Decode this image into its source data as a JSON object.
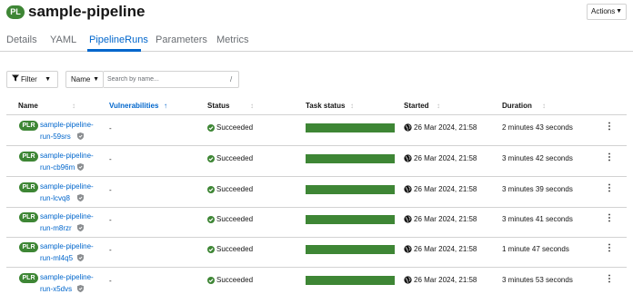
{
  "header": {
    "badge": "PL",
    "title": "sample-pipeline",
    "actions_label": "Actions"
  },
  "tabs": [
    {
      "label": "Details"
    },
    {
      "label": "YAML"
    },
    {
      "label": "PipelineRuns"
    },
    {
      "label": "Parameters"
    },
    {
      "label": "Metrics"
    }
  ],
  "toolbar": {
    "filter_label": "Filter",
    "name_select": "Name",
    "search_placeholder": "Search by name...",
    "shortcut_hint": "/"
  },
  "table": {
    "columns": [
      "Name",
      "Vulnerabilities",
      "Status",
      "Task status",
      "Started",
      "Duration"
    ],
    "rows": [
      {
        "badge": "PLR",
        "name": "sample-pipeline-run-59srs",
        "name_line1": "sample-pipeline-",
        "name_line2": "run-59srs",
        "vulnerabilities": "-",
        "status": "Succeeded",
        "task_progress": 1.0,
        "started": "26 Mar 2024, 21:58",
        "duration": "2 minutes 43 seconds"
      },
      {
        "badge": "PLR",
        "name": "sample-pipeline-run-cb96m",
        "name_line1": "sample-pipeline-",
        "name_line2": "run-cb96m",
        "vulnerabilities": "-",
        "status": "Succeeded",
        "task_progress": 1.0,
        "started": "26 Mar 2024, 21:58",
        "duration": "3 minutes 42 seconds"
      },
      {
        "badge": "PLR",
        "name": "sample-pipeline-run-lcvq8",
        "name_line1": "sample-pipeline-",
        "name_line2": "run-lcvq8",
        "vulnerabilities": "-",
        "status": "Succeeded",
        "task_progress": 1.0,
        "started": "26 Mar 2024, 21:58",
        "duration": "3 minutes 39 seconds"
      },
      {
        "badge": "PLR",
        "name": "sample-pipeline-run-m8rzr",
        "name_line1": "sample-pipeline-",
        "name_line2": "run-m8rzr",
        "vulnerabilities": "-",
        "status": "Succeeded",
        "task_progress": 1.0,
        "started": "26 Mar 2024, 21:58",
        "duration": "3 minutes 41 seconds"
      },
      {
        "badge": "PLR",
        "name": "sample-pipeline-run-ml4q5",
        "name_line1": "sample-pipeline-",
        "name_line2": "run-ml4q5",
        "vulnerabilities": "-",
        "status": "Succeeded",
        "task_progress": 1.0,
        "started": "26 Mar 2024, 21:58",
        "duration": "1 minute 47 seconds"
      },
      {
        "badge": "PLR",
        "name": "sample-pipeline-run-x5dvs",
        "name_line1": "sample-pipeline-",
        "name_line2": "run-x5dvs",
        "vulnerabilities": "-",
        "status": "Succeeded",
        "task_progress": 1.0,
        "started": "26 Mar 2024, 21:58",
        "duration": "3 minutes 53 seconds"
      }
    ]
  },
  "colors": {
    "accent": "#0066cc",
    "success": "#3e8635",
    "border": "#d2d2d2"
  },
  "icons": {
    "filter": "filter-icon",
    "status": "check-circle-icon",
    "started": "globe-icon",
    "signed": "shield-icon",
    "row_actions": "kebab-icon"
  }
}
